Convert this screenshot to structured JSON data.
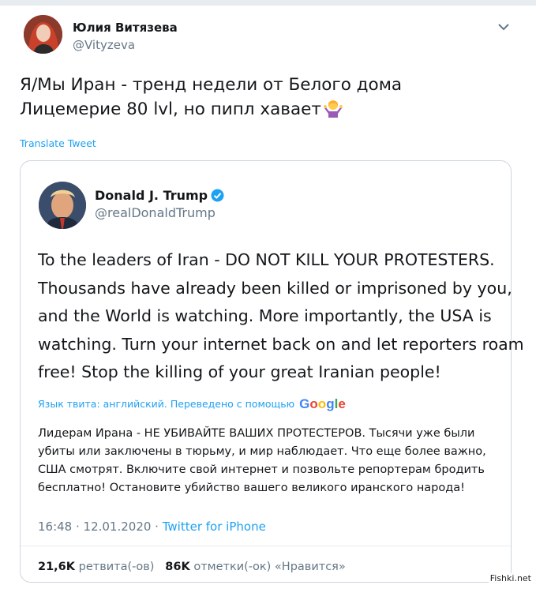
{
  "author": {
    "name": "Юлия Витязева",
    "handle": "@Vityzeva"
  },
  "tweet": {
    "lines": [
      "Я/Мы Иран - тренд недели от Белого дома",
      "Лицемерие 80 lvl, но пипл хавает"
    ],
    "emoji": "person-shrugging-emoji",
    "translate_label": "Translate Tweet"
  },
  "quoted": {
    "name": "Donald J. Trump",
    "handle": "@realDonaldTrump",
    "lines": [
      "To the leaders of Iran - DO NOT KILL YOUR PROTESTERS.",
      "Thousands have already been killed or imprisoned by you,",
      "and the World is watching. More importantly, the USA is",
      "watching. Turn your internet back on and let reporters roam",
      "free! Stop the killing of your great Iranian people!"
    ],
    "translation_note": "Язык твита: английский. Переведено с помощью",
    "translation_brand": "Google",
    "translation_lines": [
      "Лидерам Ирана - НЕ УБИВАЙТЕ ВАШИХ ПРОТЕСТЕРОВ. Тысячи уже были",
      "убиты или заключены в тюрьму, и мир наблюдает. Что еще более важно,",
      "США смотрят. Включите свой интернет и позвольте репортерам бродить",
      "бесплатно! Остановите убийство вашего великого иранского народа!"
    ],
    "time": "16:48 · 12.01.2020 ·",
    "source": "Twitter for iPhone",
    "retweets_count": "21,6K",
    "retweets_label": "ретвита(-ов)",
    "likes_count": "86K",
    "likes_label": "отметки(-ок) «Нравится»"
  },
  "watermark": "Fishki.net",
  "colors": {
    "link": "#1da1f2",
    "muted": "#657786",
    "text": "#14171a",
    "border": "#ccd6dd"
  }
}
